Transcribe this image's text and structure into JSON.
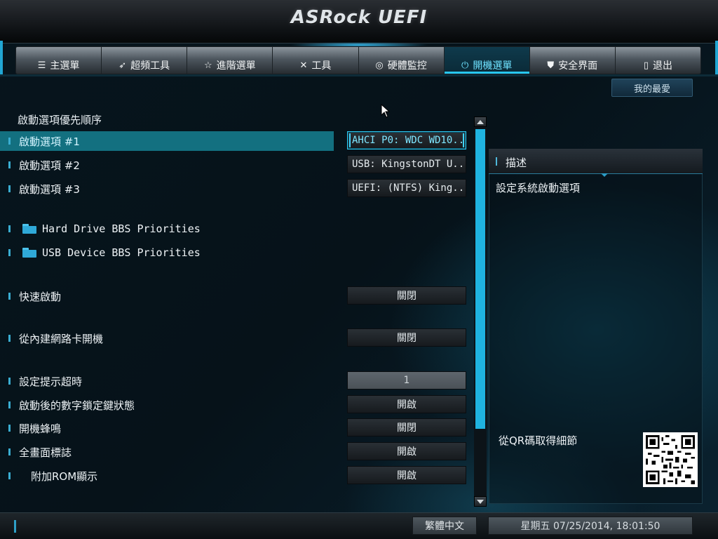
{
  "header": {
    "brand": "ASRock UEFI"
  },
  "tabs": [
    {
      "label": "主選單",
      "icon": "list-icon",
      "glyph": "☰"
    },
    {
      "label": "超頻工具",
      "icon": "rocket-icon",
      "glyph": "🚀"
    },
    {
      "label": "進階選單",
      "icon": "star-icon",
      "glyph": "☆"
    },
    {
      "label": "工具",
      "icon": "tools-icon",
      "glyph": "✕"
    },
    {
      "label": "硬體監控",
      "icon": "monitor-icon",
      "glyph": "◎"
    },
    {
      "label": "開機選單",
      "icon": "power-icon",
      "glyph": "⏻",
      "active": true
    },
    {
      "label": "安全界面",
      "icon": "shield-icon",
      "glyph": "⛊"
    },
    {
      "label": "退出",
      "icon": "exit-icon",
      "glyph": "▯"
    }
  ],
  "favorites_label": "我的最愛",
  "section_title": "啟動選項優先順序",
  "boot_options": [
    {
      "label": "啟動選項 #1",
      "value": "AHCI P0: WDC WD10..."
    },
    {
      "label": "啟動選項 #2",
      "value": "USB: KingstonDT U..."
    },
    {
      "label": "啟動選項 #3",
      "value": "UEFI: (NTFS) King..."
    }
  ],
  "folders": [
    {
      "label": "Hard Drive BBS Priorities"
    },
    {
      "label": "USB Device BBS Priorities"
    }
  ],
  "settings": {
    "fast_boot": {
      "label": "快速啟動",
      "value": "關閉"
    },
    "onboard_lan_boot": {
      "label": "從內建網路卡開機",
      "value": "關閉"
    },
    "setup_prompt_timeout": {
      "label": "設定提示超時",
      "value": "1"
    },
    "bootup_numlock": {
      "label": "啟動後的數字鎖定鍵狀態",
      "value": "開啟"
    },
    "boot_beep": {
      "label": "開機蜂鳴",
      "value": "關閉"
    },
    "full_screen_logo": {
      "label": "全畫面標誌",
      "value": "開啟"
    },
    "addon_rom_display": {
      "label": "附加ROM顯示",
      "value": "開啟"
    }
  },
  "description": {
    "title": "描述",
    "text": "設定系統啟動選項",
    "qr_label": "從QR碼取得細節"
  },
  "footer": {
    "language": "繁體中文",
    "datetime": "星期五 07/25/2014, 18:01:50"
  },
  "colors": {
    "accent": "#1fb3e0",
    "selected_row": "#137080"
  }
}
